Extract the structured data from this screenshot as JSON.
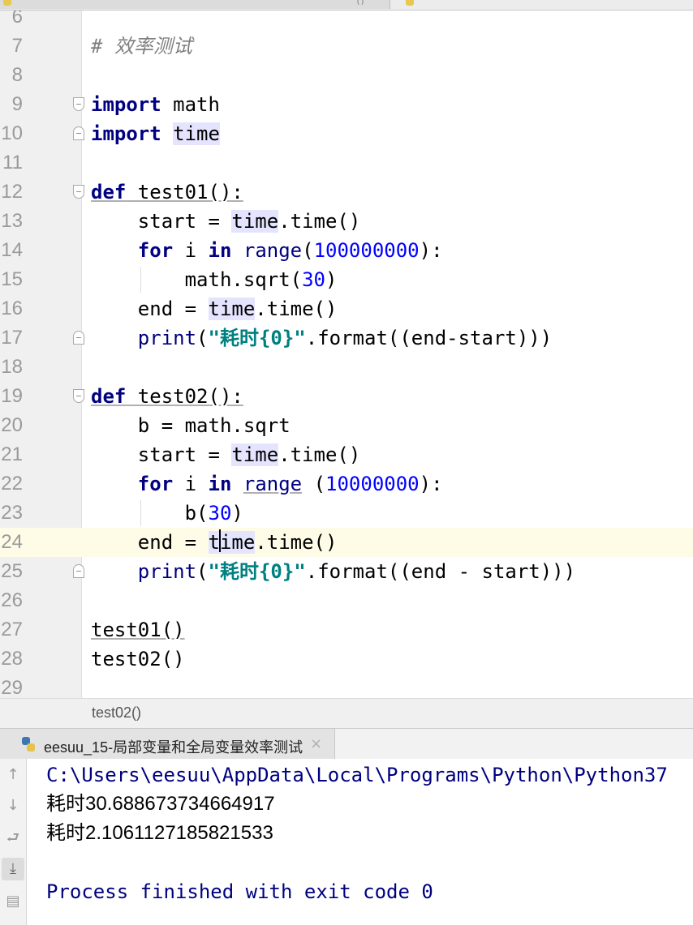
{
  "tabs": {
    "active_close_glyph": "()"
  },
  "editor": {
    "lines": [
      {
        "n": "6",
        "code": ""
      },
      {
        "n": "7",
        "code": "# 效率测试"
      },
      {
        "n": "8",
        "code": ""
      },
      {
        "n": "9",
        "code": "import math"
      },
      {
        "n": "10",
        "code": "import time"
      },
      {
        "n": "11",
        "code": ""
      },
      {
        "n": "12",
        "code": "def test01():"
      },
      {
        "n": "13",
        "code": "    start = time.time()"
      },
      {
        "n": "14",
        "code": "    for i in range(100000000):"
      },
      {
        "n": "15",
        "code": "        math.sqrt(30)"
      },
      {
        "n": "16",
        "code": "    end = time.time()"
      },
      {
        "n": "17",
        "code": "    print(\"耗时{0}\".format((end-start)))"
      },
      {
        "n": "18",
        "code": ""
      },
      {
        "n": "19",
        "code": "def test02():"
      },
      {
        "n": "20",
        "code": "    b = math.sqrt"
      },
      {
        "n": "21",
        "code": "    start = time.time()"
      },
      {
        "n": "22",
        "code": "    for i in range (10000000):"
      },
      {
        "n": "23",
        "code": "        b(30)"
      },
      {
        "n": "24",
        "code": "    end = time.time()"
      },
      {
        "n": "25",
        "code": "    print(\"耗时{0}\".format((end - start)))"
      },
      {
        "n": "26",
        "code": ""
      },
      {
        "n": "27",
        "code": "test01()"
      },
      {
        "n": "28",
        "code": "test02()"
      },
      {
        "n": "29",
        "code": ""
      }
    ],
    "current_line": "24"
  },
  "breadcrumb": {
    "label": "test02()"
  },
  "run": {
    "tab_label": "eesuu_15-局部变量和全局变量效率测试",
    "tab_close": "×",
    "console": [
      "C:\\Users\\eesuu\\AppData\\Local\\Programs\\Python\\Python37",
      "耗时30.688673734664917",
      "耗时2.1061127185821533",
      "",
      "Process finished with exit code 0"
    ],
    "toolbar": [
      {
        "name": "scroll-up-icon",
        "glyph": "↑"
      },
      {
        "name": "scroll-down-icon",
        "glyph": "↓"
      },
      {
        "name": "soft-wrap-icon",
        "glyph": "⮐"
      },
      {
        "name": "scroll-to-end-icon",
        "glyph": "⤓"
      },
      {
        "name": "print-icon",
        "glyph": "▤"
      }
    ]
  },
  "colors": {
    "keyword": "#000080",
    "number": "#0000ff",
    "string": "#008080",
    "comment": "#808080",
    "current_line": "#fefbe6",
    "identifier_highlight": "#e4e4ff"
  }
}
